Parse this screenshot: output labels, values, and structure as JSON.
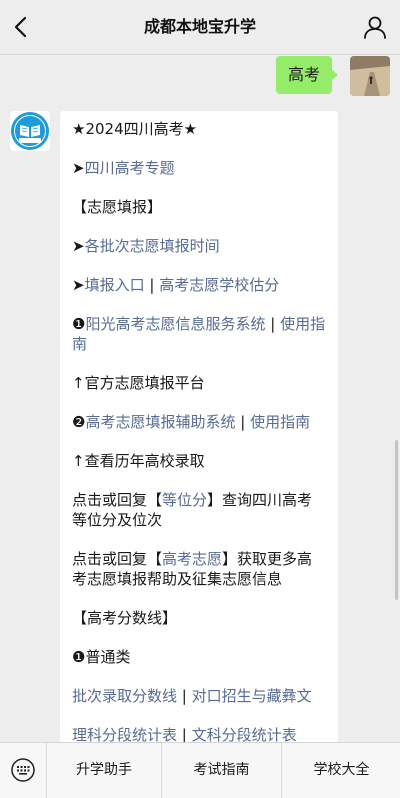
{
  "header": {
    "title": "成都本地宝升学"
  },
  "outgoing": {
    "text": "高考"
  },
  "incoming": {
    "paragraphs": [
      [
        {
          "t": "★2024四川高考★",
          "link": false
        }
      ],
      [
        {
          "t": "➤",
          "link": false
        },
        {
          "t": "四川高考专题",
          "link": true
        }
      ],
      [
        {
          "t": "【志愿填报】",
          "link": false
        }
      ],
      [
        {
          "t": "➤",
          "link": false
        },
        {
          "t": "各批次志愿填报时间",
          "link": true
        }
      ],
      [
        {
          "t": "➤",
          "link": false
        },
        {
          "t": "填报入口",
          "link": true
        },
        {
          "t": " | ",
          "link": false
        },
        {
          "t": "高考志愿学校估分",
          "link": true
        }
      ],
      [
        {
          "t": "❶",
          "link": false
        },
        {
          "t": "阳光高考志愿信息服务系统",
          "link": true
        },
        {
          "t": " | ",
          "link": false
        },
        {
          "t": "使用指南",
          "link": true
        }
      ],
      [
        {
          "t": "↑官方志愿填报平台",
          "link": false
        }
      ],
      [
        {
          "t": "❷",
          "link": false
        },
        {
          "t": "高考志愿填报辅助系统",
          "link": true
        },
        {
          "t": " | ",
          "link": false
        },
        {
          "t": "使用指南",
          "link": true
        }
      ],
      [
        {
          "t": "↑查看历年高校录取",
          "link": false
        }
      ],
      [
        {
          "t": "点击或回复【",
          "link": false
        },
        {
          "t": "等位分",
          "link": true
        },
        {
          "t": "】查询四川高考等位分及位次",
          "link": false
        }
      ],
      [
        {
          "t": "点击或回复【",
          "link": false
        },
        {
          "t": "高考志愿",
          "link": true
        },
        {
          "t": "】获取更多高考志愿填报帮助及征集志愿信息",
          "link": false
        }
      ],
      [
        {
          "t": "【高考分数线】",
          "link": false
        }
      ],
      [
        {
          "t": "❶普通类",
          "link": false
        }
      ],
      [
        {
          "t": "批次录取分数线",
          "link": true
        },
        {
          "t": " | ",
          "link": false
        },
        {
          "t": "对口招生与藏彝文",
          "link": true
        }
      ],
      [
        {
          "t": "理科分段统计表",
          "link": true
        },
        {
          "t": " | ",
          "link": false
        },
        {
          "t": "文科分段统计表",
          "link": true
        }
      ]
    ]
  },
  "bottom_menu": {
    "keyboard_icon": "keyboard-icon",
    "items": [
      "升学助手",
      "考试指南",
      "学校大全"
    ]
  },
  "colors": {
    "link": "#576b95",
    "outgoing_bubble": "#95ec69",
    "brand": "#1e9ae0"
  }
}
